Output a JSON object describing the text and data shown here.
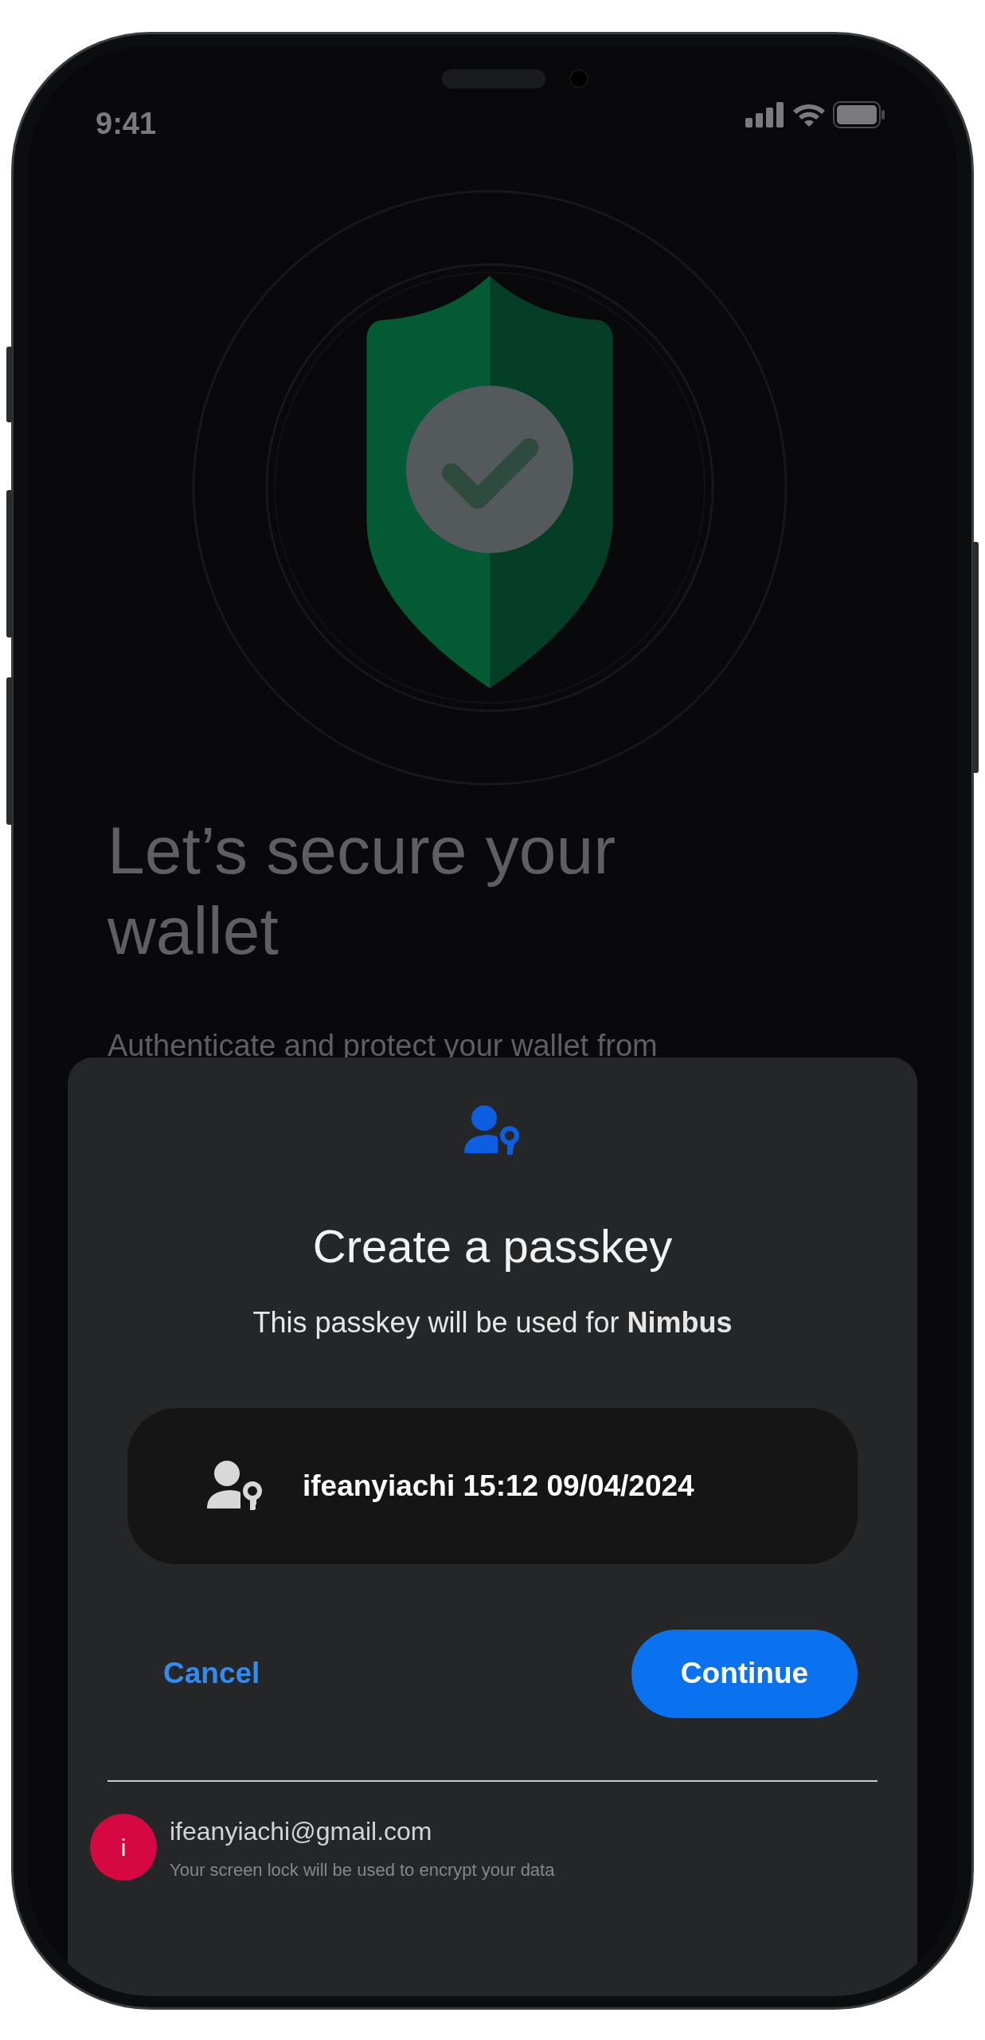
{
  "status_bar": {
    "time": "9:41"
  },
  "background": {
    "title": "Let’s secure your wallet",
    "subtitle": "Authenticate and protect your wallet from"
  },
  "sheet": {
    "title": "Create a passkey",
    "message": "This passkey will be used for **Nimbus**",
    "account": {
      "label": "ifeanyiachi 15:12 09/04/2024"
    },
    "buttons": [
      {
        "kind": "text",
        "label": "Cancel"
      },
      {
        "kind": "filled",
        "label": "Continue"
      }
    ],
    "footer": {
      "avatar": "i",
      "color": "#d50843",
      "email": "ifeanyiachi@gmail.com",
      "note": "Your screen lock will be used to encrypt your data"
    }
  }
}
